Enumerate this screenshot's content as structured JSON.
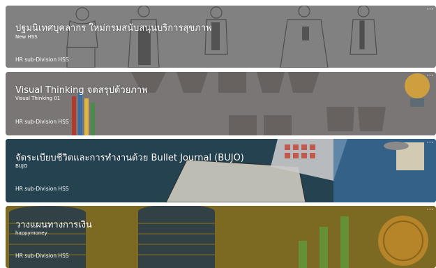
{
  "courses": [
    {
      "title": "ปฐมนิเทศบุคลากร ใหม่กรมสนับสนุนบริการสุขภาพ",
      "code": "New HSS",
      "department": "HR sub-Division HSS",
      "menu": "⋯",
      "color": "#8b8b8b"
    },
    {
      "title": "Visual Thinking จดสรุปด้วยภาพ",
      "code": "Visual Thinking 01",
      "department": "HR sub-Division HSS",
      "menu": "⋯",
      "color": "#7a7675"
    },
    {
      "title": "จัดระเบียบชีวิตและการทำงานด้วย Bullet Journal (BUJO)",
      "code": "BUJO",
      "department": "HR sub-Division HSS",
      "menu": "⋯",
      "color": "#2b4a5a"
    },
    {
      "title": "วางแผนทางการเงิน",
      "code": "happymoney",
      "department": "HR sub-Division HSS",
      "menu": "⋯",
      "color": "#7d6a22"
    }
  ]
}
